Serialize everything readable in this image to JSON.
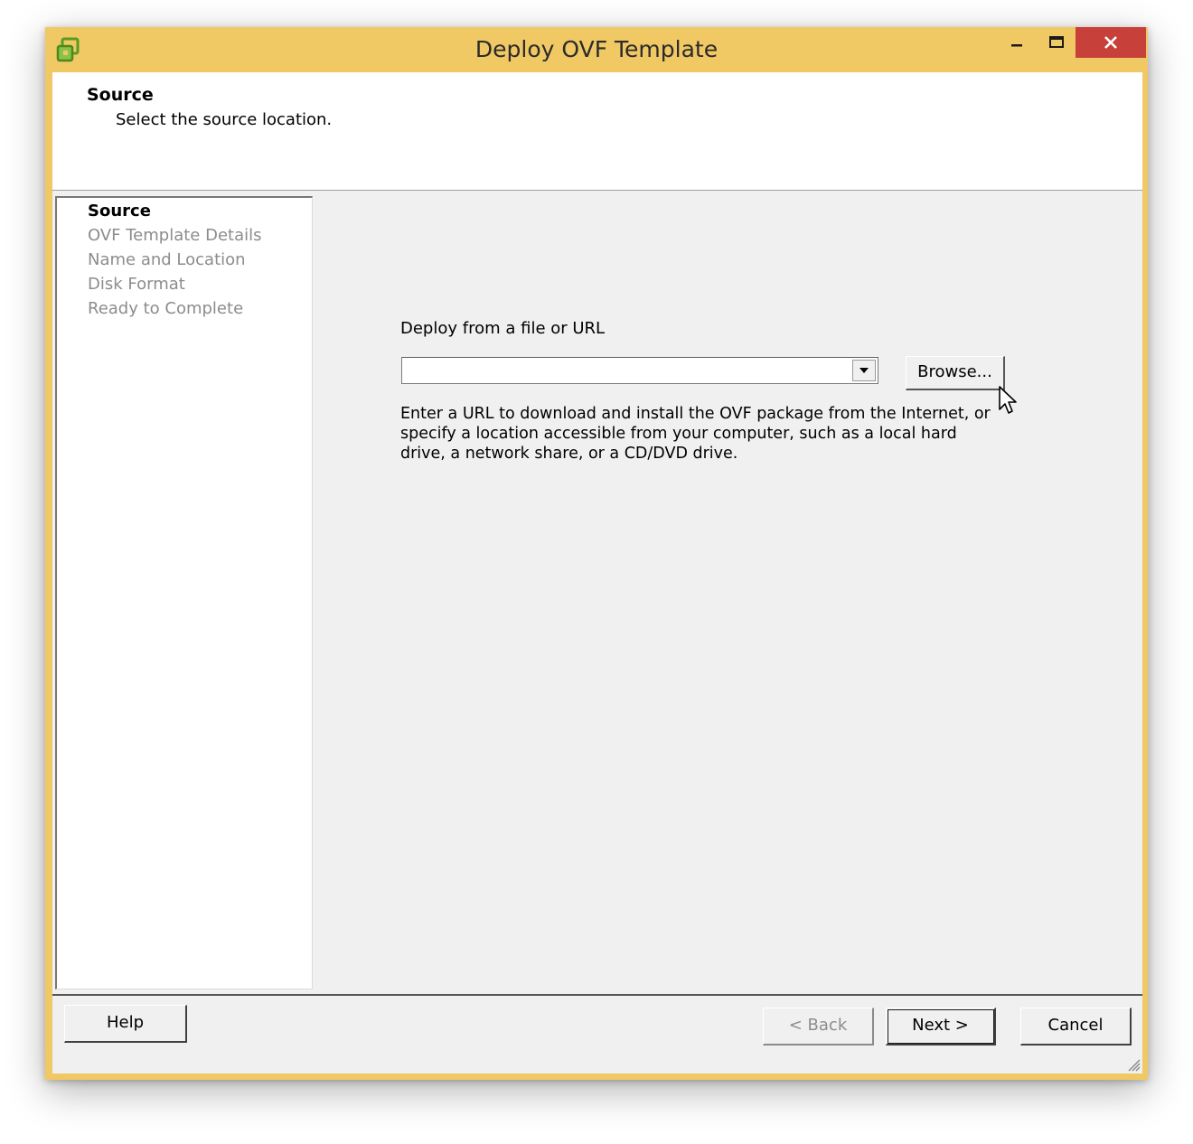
{
  "window": {
    "title": "Deploy OVF Template",
    "colors": {
      "frame": "#f0c864",
      "close_button": "#c7403a",
      "client_bg": "#f0f0f0"
    },
    "controls": {
      "minimize_icon": "minimize-icon",
      "maximize_icon": "maximize-icon",
      "close_icon": "close-icon"
    }
  },
  "header": {
    "title": "Source",
    "subtitle": "Select the source location."
  },
  "steps": [
    {
      "label": "Source",
      "active": true
    },
    {
      "label": "OVF Template Details",
      "active": false
    },
    {
      "label": "Name and Location",
      "active": false
    },
    {
      "label": "Disk Format",
      "active": false
    },
    {
      "label": "Ready to Complete",
      "active": false
    }
  ],
  "source": {
    "label": "Deploy from a file or URL",
    "value": "",
    "browse_label": "Browse...",
    "hint": "Enter a URL to download and install the OVF package from the Internet, or specify a location accessible from your computer, such as a local hard drive, a network share, or a CD/DVD drive."
  },
  "footer": {
    "help_label": "Help",
    "back_label": "< Back",
    "next_label": "Next >",
    "cancel_label": "Cancel"
  }
}
